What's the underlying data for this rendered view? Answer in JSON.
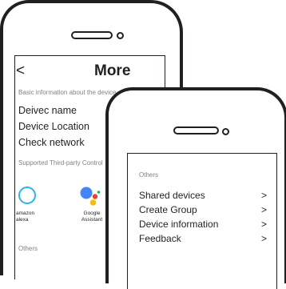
{
  "more_screen": {
    "back_glyph": "<",
    "title": "More",
    "basic_info_label": "Basic information about the device",
    "items": [
      {
        "label": "Deivec name"
      },
      {
        "label": "Device Location"
      },
      {
        "label": "Check network"
      }
    ],
    "third_party_label": "Supported Third-party Control",
    "third_party": [
      {
        "label": "amazon alexa",
        "icon": "alexa-icon",
        "color": "#29b6e8"
      },
      {
        "label": "Google Assistant",
        "icon": "google-assistant-icon"
      }
    ],
    "others_label": "Others"
  },
  "others_screen": {
    "others_label": "Others",
    "chevron_glyph": ">",
    "items": [
      {
        "label": "Shared devices"
      },
      {
        "label": "Create Group"
      },
      {
        "label": "Device information"
      },
      {
        "label": "Feedback"
      }
    ]
  },
  "colors": {
    "outline": "#231f20",
    "muted_text": "#808285",
    "alexa_blue": "#29b6e8",
    "google_blue": "#4285f4",
    "google_red": "#ea4335",
    "google_yellow": "#fbbc05",
    "google_green": "#34a853"
  }
}
